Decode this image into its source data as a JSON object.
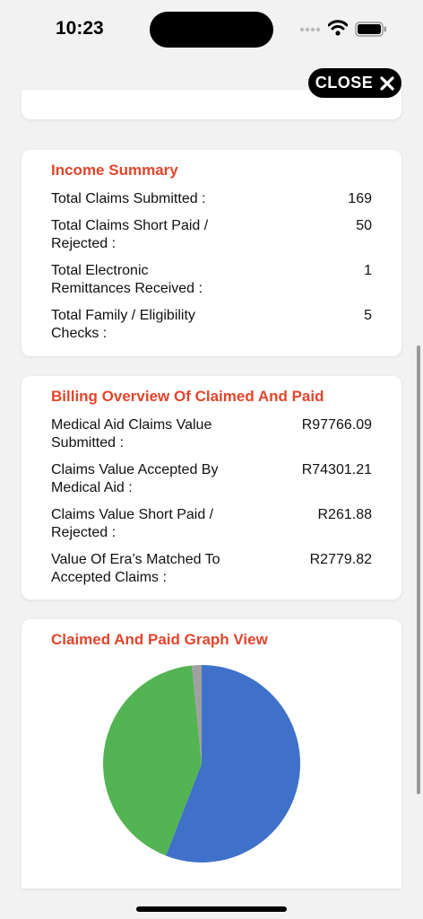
{
  "status": {
    "time": "10:23"
  },
  "close_button": {
    "label": "CLOSE"
  },
  "income_summary": {
    "title": "Income Summary",
    "rows": [
      {
        "label": "Total Claims Submitted :",
        "value": "169"
      },
      {
        "label": "Total Claims Short Paid / Rejected :",
        "value": "50"
      },
      {
        "label": "Total Electronic Remittances Received :",
        "value": "1"
      },
      {
        "label": "Total Family / Eligibility Checks :",
        "value": "5"
      }
    ]
  },
  "billing_overview": {
    "title": "Billing Overview Of Claimed And Paid",
    "rows": [
      {
        "label": "Medical Aid Claims Value Submitted :",
        "value": "R97766.09"
      },
      {
        "label": "Claims Value Accepted By Medical Aid :",
        "value": "R74301.21"
      },
      {
        "label": "Claims Value Short Paid / Rejected :",
        "value": "R261.88"
      },
      {
        "label": "Value Of Era’s Matched To Accepted Claims :",
        "value": "R2779.82"
      }
    ]
  },
  "graph": {
    "title": "Claimed And Paid Graph View",
    "chart_data": {
      "type": "pie",
      "values": [
        97766.09,
        74301.21,
        2779.82
      ],
      "colors": [
        "#3f71ca",
        "#52b452",
        "#a0a0a0"
      ]
    }
  }
}
